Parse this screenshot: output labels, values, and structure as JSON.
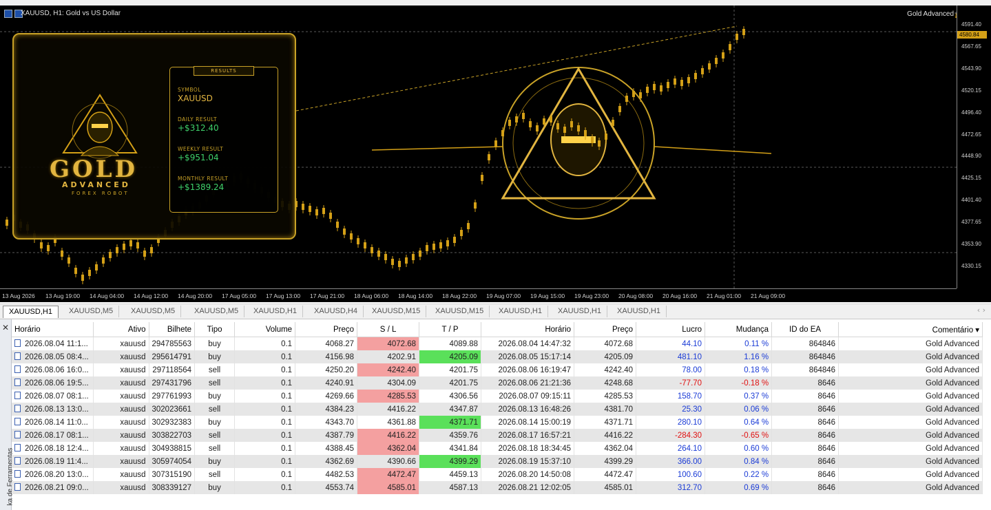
{
  "chart": {
    "window_title": "XAUUSD, H1:  Gold vs US Dollar",
    "ea_label": "Gold Advanced",
    "ea_icon": "graduation-cap-icon",
    "current_price": "4580.84",
    "price_ticks": [
      "4591.40",
      "4567.65",
      "4543.90",
      "4520.15",
      "4496.40",
      "4472.65",
      "4448.90",
      "4425.15",
      "4401.40",
      "4377.65",
      "4353.90",
      "4330.15"
    ],
    "time_ticks": [
      "13 Aug 2026",
      "13 Aug 19:00",
      "14 Aug 04:00",
      "14 Aug 12:00",
      "14 Aug 20:00",
      "17 Aug 05:00",
      "17 Aug 13:00",
      "17 Aug 21:00",
      "18 Aug 06:00",
      "18 Aug 14:00",
      "18 Aug 22:00",
      "19 Aug 07:00",
      "19 Aug 15:00",
      "19 Aug 23:00",
      "20 Aug 08:00",
      "20 Aug 16:00",
      "21 Aug 01:00",
      "21 Aug 09:00"
    ],
    "colors": {
      "candle": "#d4a017",
      "grid": "#5a5a5a",
      "buy_arrow": "#3a8fff",
      "sell_arrow": "#ff4040"
    }
  },
  "panel": {
    "logo_main": "GOLD",
    "logo_sub": "ADVANCED",
    "logo_tag": "FOREX ROBOT",
    "results_title": "RESULTS",
    "symbol_label": "SYMBOL",
    "symbol_value": "XAUUSD",
    "daily_label": "DAILY RESULT",
    "daily_value": "+$312.40",
    "weekly_label": "WEEKLY RESULT",
    "weekly_value": "+$951.04",
    "monthly_label": "MONTHLY RESULT",
    "monthly_value": "+$1389.24"
  },
  "tabs": [
    "XAUUSD,H1",
    "XAUUSD,M5",
    "XAUUSD,M5",
    "XAUUSD,M5",
    "XAUUSD,H1",
    "XAUUSD,H4",
    "XAUUSD,M15",
    "XAUUSD,M15",
    "XAUUSD,H1",
    "XAUUSD,H1",
    "XAUUSD,H1"
  ],
  "toolbox": {
    "side_label": "ka de Ferramentas",
    "columns": [
      "Horário",
      "Ativo",
      "Bilhete",
      "Tipo",
      "Volume",
      "Preço",
      "S / L",
      "T / P",
      "Horário",
      "Preço",
      "Lucro",
      "Mudança",
      "ID do EA",
      "Comentário"
    ],
    "rows": [
      {
        "open_time": "2026.08.04 11:1...",
        "symbol": "xauusd",
        "ticket": "294785563",
        "type": "buy",
        "volume": "0.1",
        "open_price": "4068.27",
        "sl": "4072.68",
        "tp": "4089.88",
        "close_time": "2026.08.04 14:47:32",
        "close_price": "4072.68",
        "profit": "44.10",
        "change": "0.11 %",
        "ea_id": "864846",
        "comment": "Gold Advanced",
        "hl": "sl",
        "neg": false
      },
      {
        "open_time": "2026.08.05 08:4...",
        "symbol": "xauusd",
        "ticket": "295614791",
        "type": "buy",
        "volume": "0.1",
        "open_price": "4156.98",
        "sl": "4202.91",
        "tp": "4205.09",
        "close_time": "2026.08.05 15:17:14",
        "close_price": "4205.09",
        "profit": "481.10",
        "change": "1.16 %",
        "ea_id": "864846",
        "comment": "Gold Advanced",
        "hl": "tp",
        "neg": false
      },
      {
        "open_time": "2026.08.06 16:0...",
        "symbol": "xauusd",
        "ticket": "297118564",
        "type": "sell",
        "volume": "0.1",
        "open_price": "4250.20",
        "sl": "4242.40",
        "tp": "4201.75",
        "close_time": "2026.08.06 16:19:47",
        "close_price": "4242.40",
        "profit": "78.00",
        "change": "0.18 %",
        "ea_id": "864846",
        "comment": "Gold Advanced",
        "hl": "sl",
        "neg": false
      },
      {
        "open_time": "2026.08.06 19:5...",
        "symbol": "xauusd",
        "ticket": "297431796",
        "type": "sell",
        "volume": "0.1",
        "open_price": "4240.91",
        "sl": "4304.09",
        "tp": "4201.75",
        "close_time": "2026.08.06 21:21:36",
        "close_price": "4248.68",
        "profit": "-77.70",
        "change": "-0.18 %",
        "ea_id": "8646",
        "comment": "Gold Advanced",
        "hl": "",
        "neg": true
      },
      {
        "open_time": "2026.08.07 08:1...",
        "symbol": "xauusd",
        "ticket": "297761993",
        "type": "buy",
        "volume": "0.1",
        "open_price": "4269.66",
        "sl": "4285.53",
        "tp": "4306.56",
        "close_time": "2026.08.07 09:15:11",
        "close_price": "4285.53",
        "profit": "158.70",
        "change": "0.37 %",
        "ea_id": "8646",
        "comment": "Gold Advanced",
        "hl": "sl",
        "neg": false
      },
      {
        "open_time": "2026.08.13 13:0...",
        "symbol": "xauusd",
        "ticket": "302023661",
        "type": "sell",
        "volume": "0.1",
        "open_price": "4384.23",
        "sl": "4416.22",
        "tp": "4347.87",
        "close_time": "2026.08.13 16:48:26",
        "close_price": "4381.70",
        "profit": "25.30",
        "change": "0.06 %",
        "ea_id": "8646",
        "comment": "Gold Advanced",
        "hl": "",
        "neg": false
      },
      {
        "open_time": "2026.08.14 11:0...",
        "symbol": "xauusd",
        "ticket": "302932383",
        "type": "buy",
        "volume": "0.1",
        "open_price": "4343.70",
        "sl": "4361.88",
        "tp": "4371.71",
        "close_time": "2026.08.14 15:00:19",
        "close_price": "4371.71",
        "profit": "280.10",
        "change": "0.64 %",
        "ea_id": "8646",
        "comment": "Gold Advanced",
        "hl": "tp",
        "neg": false
      },
      {
        "open_time": "2026.08.17 08:1...",
        "symbol": "xauusd",
        "ticket": "303822703",
        "type": "sell",
        "volume": "0.1",
        "open_price": "4387.79",
        "sl": "4416.22",
        "tp": "4359.76",
        "close_time": "2026.08.17 16:57:21",
        "close_price": "4416.22",
        "profit": "-284.30",
        "change": "-0.65 %",
        "ea_id": "8646",
        "comment": "Gold Advanced",
        "hl": "sl",
        "neg": true
      },
      {
        "open_time": "2026.08.18 12:4...",
        "symbol": "xauusd",
        "ticket": "304938815",
        "type": "sell",
        "volume": "0.1",
        "open_price": "4388.45",
        "sl": "4362.04",
        "tp": "4341.84",
        "close_time": "2026.08.18 18:34:45",
        "close_price": "4362.04",
        "profit": "264.10",
        "change": "0.60 %",
        "ea_id": "8646",
        "comment": "Gold Advanced",
        "hl": "sl",
        "neg": false
      },
      {
        "open_time": "2026.08.19 11:4...",
        "symbol": "xauusd",
        "ticket": "305974054",
        "type": "buy",
        "volume": "0.1",
        "open_price": "4362.69",
        "sl": "4390.66",
        "tp": "4399.29",
        "close_time": "2026.08.19 15:37:10",
        "close_price": "4399.29",
        "profit": "366.00",
        "change": "0.84 %",
        "ea_id": "8646",
        "comment": "Gold Advanced",
        "hl": "tp",
        "neg": false
      },
      {
        "open_time": "2026.08.20 13:0...",
        "symbol": "xauusd",
        "ticket": "307315190",
        "type": "sell",
        "volume": "0.1",
        "open_price": "4482.53",
        "sl": "4472.47",
        "tp": "4459.13",
        "close_time": "2026.08.20 14:50:08",
        "close_price": "4472.47",
        "profit": "100.60",
        "change": "0.22 %",
        "ea_id": "8646",
        "comment": "Gold Advanced",
        "hl": "sl",
        "neg": false
      },
      {
        "open_time": "2026.08.21 09:0...",
        "symbol": "xauusd",
        "ticket": "308339127",
        "type": "buy",
        "volume": "0.1",
        "open_price": "4553.74",
        "sl": "4585.01",
        "tp": "4587.13",
        "close_time": "2026.08.21 12:02:05",
        "close_price": "4585.01",
        "profit": "312.70",
        "change": "0.69 %",
        "ea_id": "8646",
        "comment": "Gold Advanced",
        "hl": "sl",
        "neg": false
      }
    ]
  }
}
